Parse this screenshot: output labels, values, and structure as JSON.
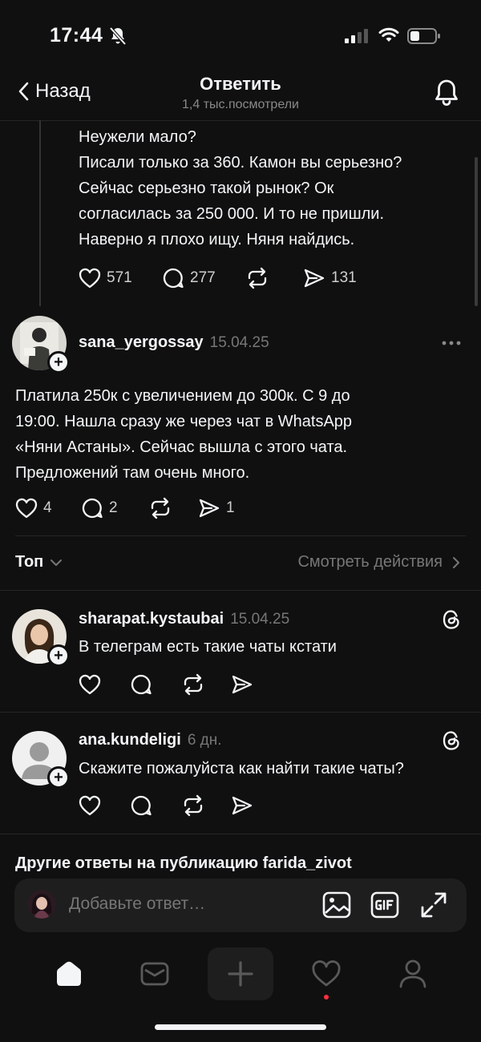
{
  "status_bar": {
    "time": "17:44"
  },
  "header": {
    "back_label": "Назад",
    "title": "Ответить",
    "subtitle": "1,4 тыс.посмотрели"
  },
  "parent_post": {
    "text_lines": [
      "Неужели мало?",
      "Писали только за 360. Камон вы серьезно?",
      "Сейчас серьезно такой рынок? Ок",
      "согласилась за 250 000. И то не пришли.",
      "Наверно я плохо ищу. Няня найдись."
    ],
    "likes": "571",
    "comments": "277",
    "shares": "131"
  },
  "reply_post": {
    "username": "sana_yergossay",
    "date": "15.04.25",
    "text_lines": [
      "Платила 250к с увеличением до 300к. С 9 до",
      "19:00. Нашла сразу же через чат в WhatsApp",
      "«Няни Астаны». Сейчас вышла с этого чата.",
      "Предложений там очень много."
    ],
    "likes": "4",
    "comments": "2",
    "shares": "1"
  },
  "sort_bar": {
    "sort_label": "Топ",
    "activity_label": "Смотреть действия"
  },
  "comments": [
    {
      "username": "sharapat.kystaubai",
      "date": "15.04.25",
      "text": "В телеграм есть такие чаты кстати"
    },
    {
      "username": "ana.kundeligi",
      "date": "6 дн.",
      "text": "Скажите пожалуйста как найти такие чаты?"
    }
  ],
  "other_replies_title": "Другие ответы на публикацию farida_zivot",
  "reply_bar": {
    "placeholder": "Добавьте ответ…"
  },
  "colors": {
    "background": "#101010",
    "text": "#f3f5f7",
    "muted": "#777777",
    "surface": "#1e1e1e",
    "notification_dot": "#ff3040"
  }
}
